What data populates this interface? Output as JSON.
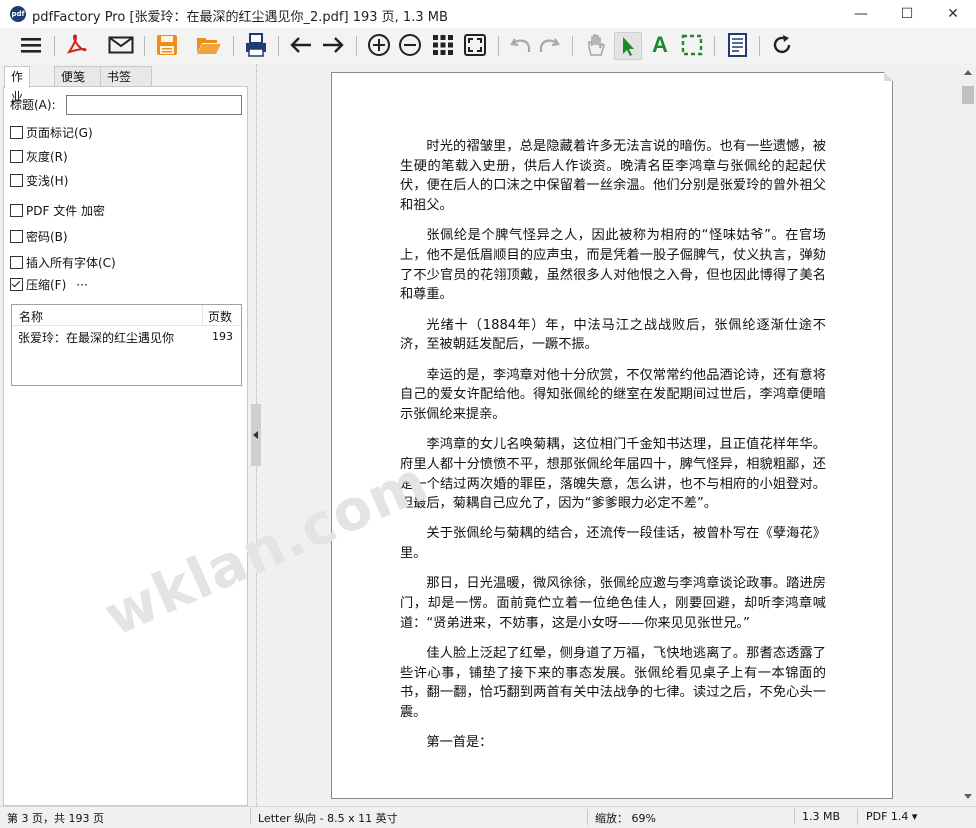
{
  "window": {
    "app_icon": "pdf",
    "title": "pdfFactory Pro [张爱玲：在最深的红尘遇见你_2.pdf] 193 页, 1.3 MB",
    "minimize": "—",
    "maximize": "☐",
    "close": "✕"
  },
  "toolbar": {
    "icons": [
      "menu-icon",
      "pdf-icon",
      "email-icon",
      "save-icon",
      "open-folder-icon",
      "print-icon",
      "back-arrow-icon",
      "forward-arrow-icon",
      "zoom-in-icon",
      "zoom-out-icon",
      "thumbnails-icon",
      "fit-page-icon",
      "undo-icon",
      "redo-icon",
      "hand-icon",
      "select-arrow-icon",
      "text-select-icon",
      "area-select-icon",
      "document-info-icon",
      "refresh-icon"
    ],
    "active": "select-arrow-icon",
    "text_tool_label": "A"
  },
  "sidebar": {
    "tabs": [
      {
        "label": "作业",
        "active": true
      },
      {
        "label": "便笺",
        "active": false
      },
      {
        "label": "书签",
        "active": false
      }
    ],
    "title_label": "标题(A):",
    "title_value": "",
    "options": [
      {
        "label": "页面标记(G)",
        "checked": false
      },
      {
        "label": "灰度(R)",
        "checked": false
      },
      {
        "label": "变浅(H)",
        "checked": false
      },
      {
        "label": "PDF 文件 加密",
        "checked": false
      },
      {
        "label": "密码(B)",
        "checked": false
      },
      {
        "label": "插入所有字体(C)",
        "checked": false
      },
      {
        "label": "压缩(F)",
        "checked": true
      }
    ],
    "more": "···",
    "list": {
      "col_name": "名称",
      "col_pages": "页数",
      "rows": [
        {
          "name": "张爱玲：在最深的红尘遇见你",
          "pages": "193"
        }
      ]
    }
  },
  "document": {
    "paragraphs": [
      "时光的褶皱里，总是隐藏着许多无法言说的暗伤。也有一些遗憾，被生硬的笔载入史册，供后人作谈资。晚清名臣李鸿章与张佩纶的起起伏伏，便在后人的口沫之中保留着一丝余温。他们分别是张爱玲的曾外祖父和祖父。",
      "张佩纶是个脾气怪异之人，因此被称为相府的“怪味姑爷”。在官场上，他不是低眉顺目的应声虫，而是凭着一股子倔脾气，仗义执言，弹劾了不少官员的花翎顶戴，虽然很多人对他恨之入骨，但也因此博得了美名和尊重。",
      "光绪十（1884年）年，中法马江之战战败后，张佩纶逐渐仕途不济，至被朝廷发配后，一蹶不振。",
      "幸运的是，李鸿章对他十分欣赏，不仅常常约他品酒论诗，还有意将自己的爱女许配给他。得知张佩纶的继室在发配期间过世后，李鸿章便暗示张佩纶来提亲。",
      "李鸿章的女儿名唤菊耦，这位相门千金知书达理，且正值花样年华。府里人都十分愤愤不平，想那张佩纶年届四十，脾气怪异，相貌粗鄙，还是一个结过两次婚的罪臣，落魄失意，怎么讲，也不与相府的小姐登对。但最后，菊耦自己应允了，因为“爹爹眼力必定不差”。",
      "关于张佩纶与菊耦的结合，还流传一段佳话，被曾朴写在《孽海花》里。",
      "那日，日光温暖，微风徐徐，张佩纶应邀与李鸿章谈论政事。踏进房门，却是一愣。面前竟伫立着一位绝色佳人，刚要回避，却听李鸿章喊道：“贤弟进来，不妨事，这是小女呀——你来见见张世兄。”",
      "佳人脸上泛起了红晕，侧身道了万福，飞快地逃离了。那耆态透露了些许心事，铺垫了接下来的事态发展。张佩纶看见桌子上有一本锦面的书，翻一翻，恰巧翻到两首有关中法战争的七律。读过之后，不免心头一震。",
      "第一首是："
    ]
  },
  "watermark": "wklan.com",
  "status": {
    "page": "第 3 页，共 193 页",
    "paper": "Letter 纵向 - 8.5 x 11 英寸",
    "zoom": "缩放：  69%",
    "size": "1.3 MB",
    "version": "PDF 1.4 ▾"
  }
}
